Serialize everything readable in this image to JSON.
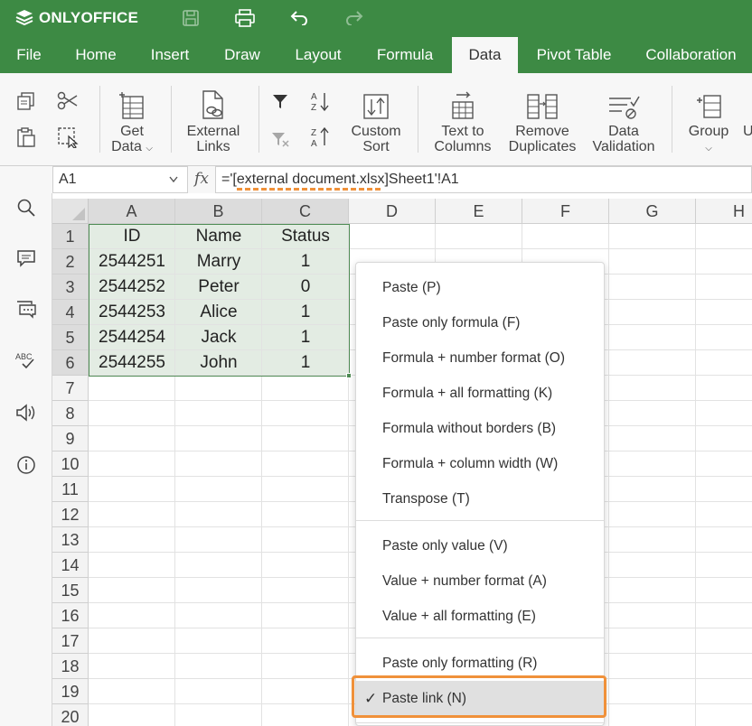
{
  "app": {
    "name": "ONLYOFFICE"
  },
  "menu_tabs": [
    "File",
    "Home",
    "Insert",
    "Draw",
    "Layout",
    "Formula",
    "Data",
    "Pivot Table",
    "Collaboration"
  ],
  "active_tab": "Data",
  "toolbar": {
    "get_data": [
      "Get",
      "Data"
    ],
    "external_links": [
      "External",
      "Links"
    ],
    "custom_sort": [
      "Custom",
      "Sort"
    ],
    "text_to_columns": [
      "Text to",
      "Columns"
    ],
    "remove_duplicates": [
      "Remove",
      "Duplicates"
    ],
    "data_validation": [
      "Data",
      "Validation"
    ],
    "group": "Group",
    "ungroup_partial": "U"
  },
  "formula_bar": {
    "cell_ref": "A1",
    "fx": "fx",
    "formula": "='[external document.xlsx]Sheet1'!A1"
  },
  "columns": [
    "A",
    "B",
    "C",
    "D",
    "E",
    "F",
    "G",
    "H"
  ],
  "rows": [
    "1",
    "2",
    "3",
    "4",
    "5",
    "6",
    "7",
    "8",
    "9",
    "10",
    "11",
    "12",
    "13",
    "14",
    "15",
    "16",
    "17",
    "18",
    "19",
    "20"
  ],
  "table": [
    [
      "ID",
      "Name",
      "Status"
    ],
    [
      "2544251",
      "Marry",
      "1"
    ],
    [
      "2544252",
      "Peter",
      "0"
    ],
    [
      "2544253",
      "Alice",
      "1"
    ],
    [
      "2544254",
      "Jack",
      "1"
    ],
    [
      "2544255",
      "John",
      "1"
    ]
  ],
  "paste_menu": {
    "group1": [
      "Paste (P)",
      "Paste only formula (F)",
      "Formula + number format (O)",
      "Formula + all formatting (K)",
      "Formula without borders (B)",
      "Formula + column width (W)",
      "Transpose (T)"
    ],
    "group2": [
      "Paste only value (V)",
      "Value + number format (A)",
      "Value + all formatting (E)"
    ],
    "group3": [
      "Paste only formatting (R)",
      "Paste link (N)"
    ],
    "checked_item": "Paste link (N)"
  },
  "colors": {
    "brand": "#3d8a44",
    "highlight": "#f0913a",
    "selection": "#e3ece3"
  }
}
